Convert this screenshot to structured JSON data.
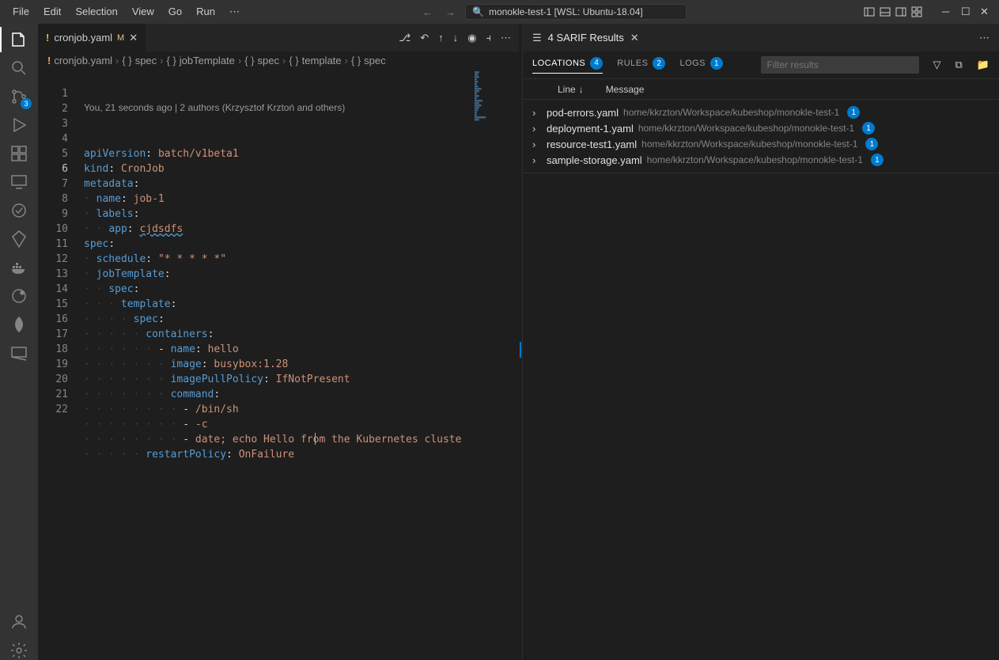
{
  "menubar": [
    "File",
    "Edit",
    "Selection",
    "View",
    "Go",
    "Run",
    "⋯"
  ],
  "titlebar": {
    "search": "monokle-test-1 [WSL: Ubuntu-18.04]"
  },
  "activitybar": {
    "scm_badge": "3"
  },
  "tab": {
    "filename": "cronjob.yaml",
    "modified": "M"
  },
  "breadcrumb": [
    "cronjob.yaml",
    "spec",
    "jobTemplate",
    "spec",
    "template",
    "spec"
  ],
  "codelens": "You, 21 seconds ago | 2 authors (Krzysztof Krztoń and others)",
  "code": {
    "lines": [
      {
        "n": "1",
        "t": [
          [
            "key",
            "apiVersion"
          ],
          [
            "punc",
            ": "
          ],
          [
            "str",
            "batch/v1beta1"
          ]
        ]
      },
      {
        "n": "2",
        "t": [
          [
            "key",
            "kind"
          ],
          [
            "punc",
            ": "
          ],
          [
            "str",
            "CronJob"
          ]
        ]
      },
      {
        "n": "3",
        "t": [
          [
            "key",
            "metadata"
          ],
          [
            "punc",
            ":"
          ]
        ]
      },
      {
        "n": "4",
        "i": 1,
        "t": [
          [
            "key",
            "name"
          ],
          [
            "punc",
            ": "
          ],
          [
            "str",
            "job-1"
          ]
        ]
      },
      {
        "n": "5",
        "i": 1,
        "t": [
          [
            "key",
            "labels"
          ],
          [
            "punc",
            ":"
          ]
        ]
      },
      {
        "n": "6",
        "i": 2,
        "t": [
          [
            "key",
            "app"
          ],
          [
            "punc",
            ": "
          ],
          [
            "wavy",
            "cjdsdfs"
          ]
        ]
      },
      {
        "n": "7",
        "t": [
          [
            "key",
            "spec"
          ],
          [
            "punc",
            ":"
          ]
        ]
      },
      {
        "n": "8",
        "i": 1,
        "t": [
          [
            "key",
            "schedule"
          ],
          [
            "punc",
            ": "
          ],
          [
            "str",
            "\"* * * * *\""
          ]
        ]
      },
      {
        "n": "9",
        "i": 1,
        "t": [
          [
            "key",
            "jobTemplate"
          ],
          [
            "punc",
            ":"
          ]
        ]
      },
      {
        "n": "10",
        "i": 2,
        "t": [
          [
            "key",
            "spec"
          ],
          [
            "punc",
            ":"
          ]
        ]
      },
      {
        "n": "11",
        "i": 3,
        "t": [
          [
            "key",
            "template"
          ],
          [
            "punc",
            ":"
          ]
        ]
      },
      {
        "n": "12",
        "i": 4,
        "t": [
          [
            "key",
            "spec"
          ],
          [
            "punc",
            ":"
          ]
        ]
      },
      {
        "n": "13",
        "i": 5,
        "t": [
          [
            "key",
            "containers"
          ],
          [
            "punc",
            ":"
          ]
        ]
      },
      {
        "n": "14",
        "i": 6,
        "t": [
          [
            "punc",
            "- "
          ],
          [
            "key",
            "name"
          ],
          [
            "punc",
            ": "
          ],
          [
            "str",
            "hello"
          ]
        ]
      },
      {
        "n": "15",
        "i": 7,
        "t": [
          [
            "key",
            "image"
          ],
          [
            "punc",
            ": "
          ],
          [
            "str",
            "busybox:1.28"
          ]
        ]
      },
      {
        "n": "16",
        "i": 7,
        "t": [
          [
            "key",
            "imagePullPolicy"
          ],
          [
            "punc",
            ": "
          ],
          [
            "str",
            "IfNotPresent"
          ]
        ]
      },
      {
        "n": "17",
        "i": 7,
        "t": [
          [
            "key",
            "command"
          ],
          [
            "punc",
            ":"
          ]
        ]
      },
      {
        "n": "18",
        "i": 8,
        "t": [
          [
            "punc",
            "- "
          ],
          [
            "str",
            "/bin/sh"
          ]
        ]
      },
      {
        "n": "19",
        "i": 8,
        "t": [
          [
            "punc",
            "- "
          ],
          [
            "str",
            "-c"
          ]
        ]
      },
      {
        "n": "20",
        "i": 8,
        "t": [
          [
            "punc",
            "- "
          ],
          [
            "str",
            "date; echo Hello from the Kubernetes cluste"
          ]
        ]
      },
      {
        "n": "21",
        "i": 5,
        "t": [
          [
            "key",
            "restartPolicy"
          ],
          [
            "punc",
            ": "
          ],
          [
            "str",
            "OnFailure"
          ]
        ]
      },
      {
        "n": "22",
        "t": []
      }
    ]
  },
  "panel": {
    "title": "4 SARIF Results",
    "tabs": [
      {
        "label": "LOCATIONS",
        "badge": "4",
        "active": true
      },
      {
        "label": "RULES",
        "badge": "2"
      },
      {
        "label": "LOGS",
        "badge": "1"
      }
    ],
    "filter_placeholder": "Filter results",
    "cols": [
      "Line",
      "Message"
    ],
    "results": [
      {
        "file": "pod-errors.yaml",
        "path": "home/kkrzton/Workspace/kubeshop/monokle-test-1",
        "count": "1"
      },
      {
        "file": "deployment-1.yaml",
        "path": "home/kkrzton/Workspace/kubeshop/monokle-test-1",
        "count": "1"
      },
      {
        "file": "resource-test1.yaml",
        "path": "home/kkrzton/Workspace/kubeshop/monokle-test-1",
        "count": "1"
      },
      {
        "file": "sample-storage.yaml",
        "path": "home/kkrzton/Workspace/kubeshop/monokle-test-1",
        "count": "1"
      }
    ]
  }
}
